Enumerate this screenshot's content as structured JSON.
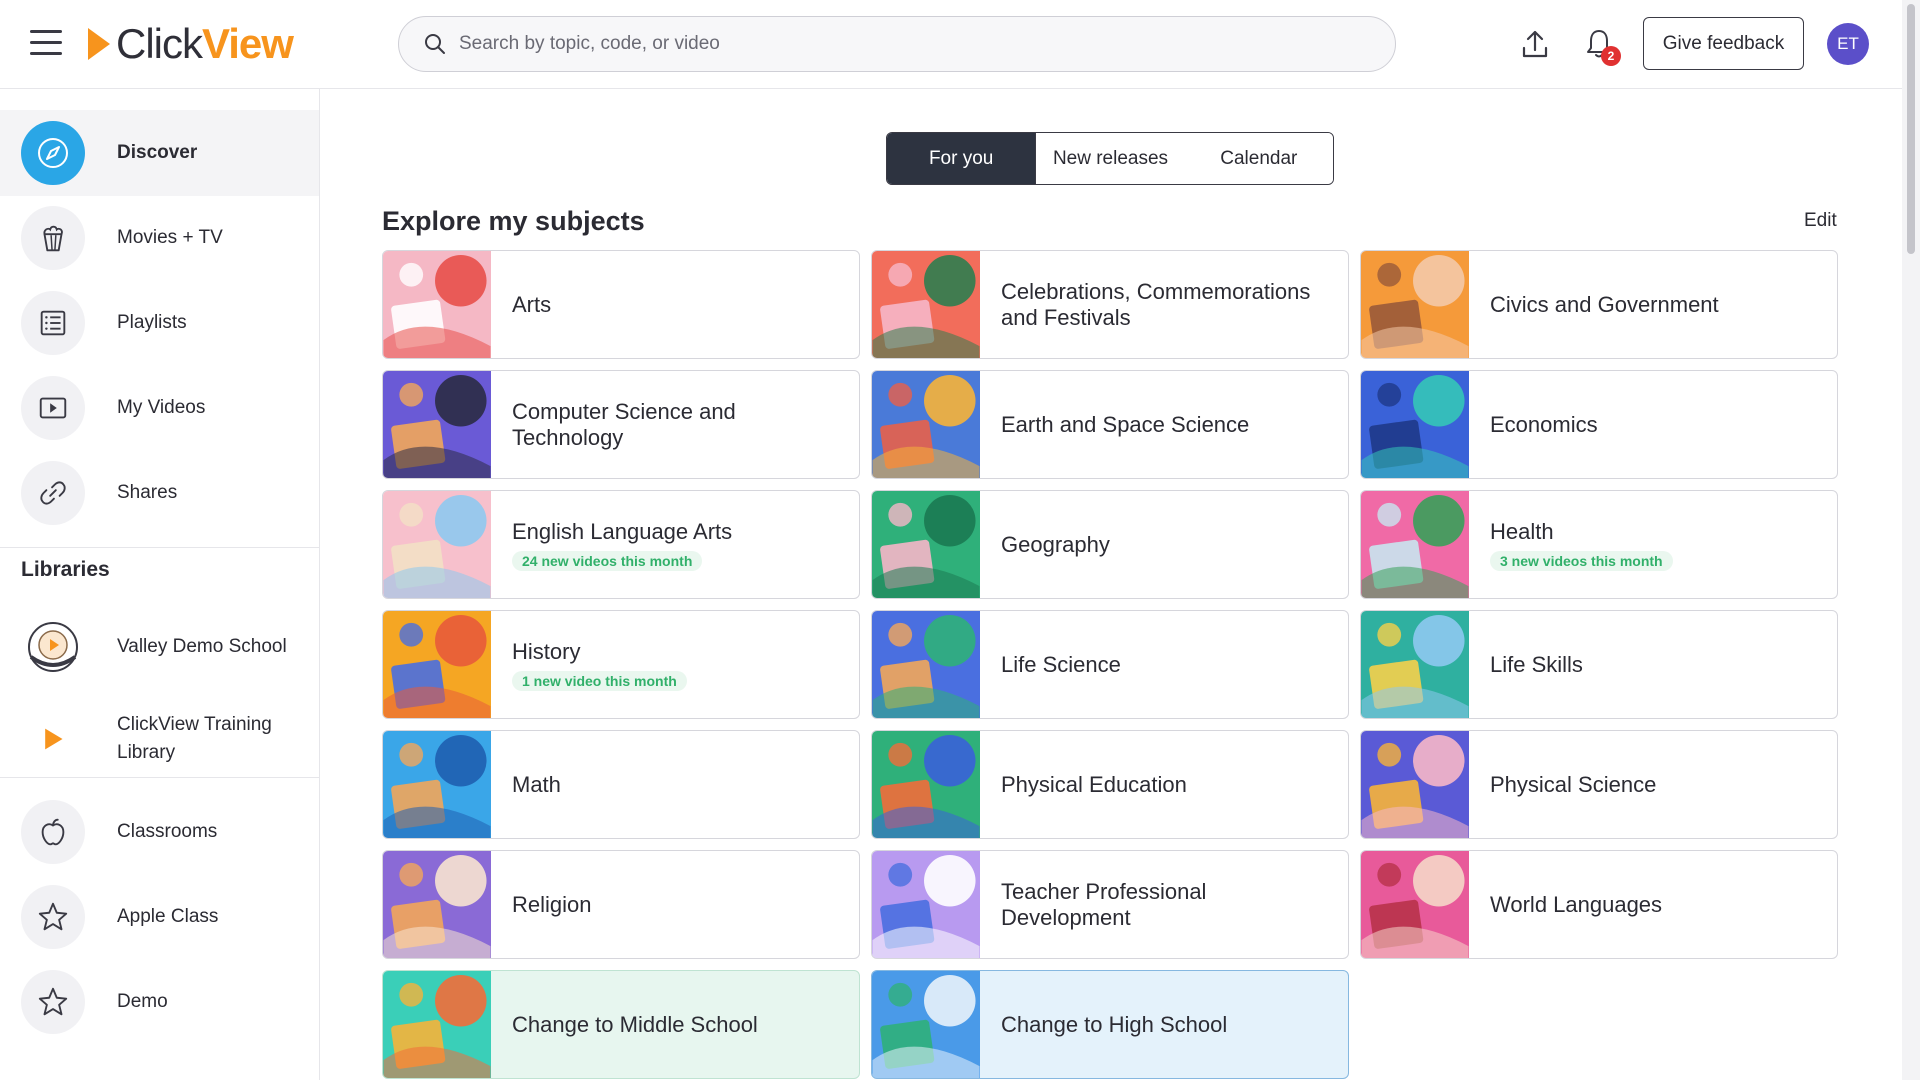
{
  "header": {
    "logo_prefix": "Click",
    "logo_suffix": "View",
    "search_placeholder": "Search by topic, code, or video",
    "notification_count": "2",
    "feedback_label": "Give feedback",
    "avatar_initials": "ET"
  },
  "sidebar": {
    "nav": [
      {
        "label": "Discover",
        "icon": "compass-icon"
      },
      {
        "label": "Movies + TV",
        "icon": "popcorn-icon"
      },
      {
        "label": "Playlists",
        "icon": "list-icon"
      },
      {
        "label": "My Videos",
        "icon": "video-play-icon"
      },
      {
        "label": "Shares",
        "icon": "link-icon"
      }
    ],
    "libraries_heading": "Libraries",
    "libraries": [
      {
        "label": "Valley Demo School",
        "icon": "school-logo-icon"
      },
      {
        "label": "ClickView Training Library",
        "icon": "clickview-play-icon"
      }
    ],
    "classes": [
      {
        "label": "Classrooms",
        "icon": "apple-icon"
      },
      {
        "label": "Apple Class",
        "icon": "star-icon"
      },
      {
        "label": "Demo",
        "icon": "star-icon"
      }
    ]
  },
  "tabs": [
    {
      "label": "For you",
      "active": true
    },
    {
      "label": "New releases",
      "active": false
    },
    {
      "label": "Calendar",
      "active": false
    }
  ],
  "section": {
    "title": "Explore my subjects",
    "edit_label": "Edit"
  },
  "subjects": [
    {
      "title": "Arts",
      "badge": "",
      "colors": [
        "#f5b8c5",
        "#e8504a",
        "#ffffff"
      ]
    },
    {
      "title": "Celebrations, Commemorations and Festivals",
      "badge": "",
      "colors": [
        "#f26d5b",
        "#2e7d4f",
        "#f6b6c8"
      ]
    },
    {
      "title": "Civics and Government",
      "badge": "",
      "colors": [
        "#f59a3a",
        "#f4c9a8",
        "#9a5a3a"
      ]
    },
    {
      "title": "Computer Science and Technology",
      "badge": "",
      "colors": [
        "#6a5ad6",
        "#2b2b45",
        "#f2a65a"
      ]
    },
    {
      "title": "Earth and Space Science",
      "badge": "",
      "colors": [
        "#4a7ad8",
        "#f6b23a",
        "#e8604a"
      ]
    },
    {
      "title": "Economics",
      "badge": "",
      "colors": [
        "#3a62d8",
        "#35c6b8",
        "#1f3a8a"
      ]
    },
    {
      "title": "English Language Arts",
      "badge": "24 new videos this month",
      "colors": [
        "#f7c0cc",
        "#8ec9ef",
        "#f2e0c5"
      ]
    },
    {
      "title": "Geography",
      "badge": "",
      "colors": [
        "#2fb07a",
        "#1b7a52",
        "#f6b6c8"
      ]
    },
    {
      "title": "Health",
      "badge": "3 new videos this month",
      "colors": [
        "#f06aa6",
        "#39a05a",
        "#c8e6f0"
      ]
    },
    {
      "title": "History",
      "badge": "1 new video this month",
      "colors": [
        "#f5a623",
        "#e85b3a",
        "#4a6fe0"
      ]
    },
    {
      "title": "Life Science",
      "badge": "",
      "colors": [
        "#4a6fe0",
        "#2fb07a",
        "#f2a65a"
      ]
    },
    {
      "title": "Life Skills",
      "badge": "",
      "colors": [
        "#2fb0a0",
        "#8ec9ef",
        "#f6d04a"
      ]
    },
    {
      "title": "Math",
      "badge": "",
      "colors": [
        "#3aa6e8",
        "#1f5fb0",
        "#f2a65a"
      ]
    },
    {
      "title": "Physical Education",
      "badge": "",
      "colors": [
        "#2fb07a",
        "#3a62d8",
        "#f26d3a"
      ]
    },
    {
      "title": "Physical Science",
      "badge": "",
      "colors": [
        "#5a5ad6",
        "#f6b6c8",
        "#f6b23a"
      ]
    },
    {
      "title": "Religion",
      "badge": "",
      "colors": [
        "#8a6ad6",
        "#f7e3d0",
        "#f2a65a"
      ]
    },
    {
      "title": "Teacher Professional Development",
      "badge": "",
      "colors": [
        "#b89af0",
        "#ffffff",
        "#4a6fe0"
      ]
    },
    {
      "title": "World Languages",
      "badge": "",
      "colors": [
        "#e85a9a",
        "#f5d6c8",
        "#b8324a"
      ]
    },
    {
      "title": "Change to Middle School",
      "badge": "",
      "colors": [
        "#3acfb8",
        "#f26d3a",
        "#f6b23a"
      ]
    },
    {
      "title": "Change to High School",
      "badge": "",
      "colors": [
        "#4a9ae8",
        "#e8f2fb",
        "#2fb07a"
      ]
    }
  ]
}
